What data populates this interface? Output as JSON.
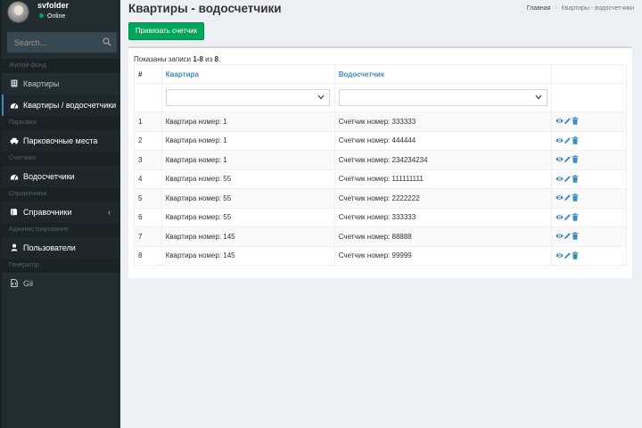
{
  "sidebar": {
    "user": {
      "name": "svfolder",
      "status": "Online"
    },
    "search_placeholder": "Search...",
    "sections": [
      {
        "header": "Жилой фонд"
      },
      {
        "header": "Парковка"
      },
      {
        "header": "Счетчики"
      },
      {
        "header": "Справочники"
      },
      {
        "header": "Администрирование"
      },
      {
        "header": "Генератор"
      }
    ],
    "items": [
      {
        "label": "Квартиры",
        "icon": "building-icon"
      },
      {
        "label": "Квартиры / водосчетчики",
        "icon": "dashboard-icon"
      },
      {
        "label": "Парковочные места",
        "icon": "car-icon"
      },
      {
        "label": "Водосчетчики",
        "icon": "dashboard-icon"
      },
      {
        "label": "Справочники",
        "icon": "book-icon",
        "chevron": "‹"
      },
      {
        "label": "Пользователи",
        "icon": "user-icon"
      },
      {
        "label": "Gii",
        "icon": "file-code-icon"
      }
    ]
  },
  "page": {
    "title": "Квартиры - водосчетчики",
    "breadcrumb": {
      "home": "Главная",
      "separator": ">",
      "current": "Квартиры - водосчетчики"
    },
    "bind_button": "Привязать счетчик",
    "summary": {
      "prefix": "Показаны записи ",
      "range": "1-8",
      "middle": " из ",
      "total": "8",
      "suffix": "."
    }
  },
  "table": {
    "columns": [
      "#",
      "Квартира",
      "Водосчетчик",
      ""
    ],
    "rows": [
      {
        "num": "1",
        "flat": "Квартира номер: 1",
        "meter": "Счетчик номер: 333333"
      },
      {
        "num": "2",
        "flat": "Квартира номер: 1",
        "meter": "Счетчик номер: 444444"
      },
      {
        "num": "3",
        "flat": "Квартира номер: 1",
        "meter": "Счетчик номер: 234234234"
      },
      {
        "num": "4",
        "flat": "Квартира номер: 55",
        "meter": "Счетчик номер: 111111111"
      },
      {
        "num": "5",
        "flat": "Квартира номер: 55",
        "meter": "Счетчик номер: 2222222"
      },
      {
        "num": "6",
        "flat": "Квартира номер: 55",
        "meter": "Счетчик номер: 333333"
      },
      {
        "num": "7",
        "flat": "Квартира номер: 145",
        "meter": "Счетчик номер: 88888"
      },
      {
        "num": "8",
        "flat": "Квартира номер: 145",
        "meter": "Счетчик номер: 99999"
      }
    ],
    "action_icons": [
      "eye-icon",
      "pencil-icon",
      "trash-icon"
    ]
  },
  "colors": {
    "sidebar_bg": "#222d32",
    "sidebar_header_bg": "#1a2226",
    "accent": "#3c8dbc",
    "success": "#00a65a",
    "online": "#00a65a"
  }
}
